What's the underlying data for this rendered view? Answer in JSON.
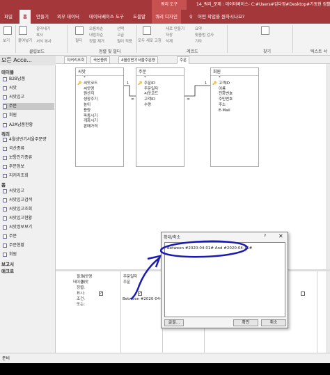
{
  "titlebar": {
    "context_tab": "쿼리 도구",
    "path": "14_쿼리_문제 : 데이터베이스- C:#Users#김다영#Desktop#기동현 컴활#"
  },
  "menu": {
    "tabs": [
      "파일",
      "홈",
      "만들기",
      "외부 데이터",
      "데이터베이스 도구",
      "도움말",
      "쿼리 디자인"
    ],
    "tell_me": "어떤 작업을 원하시나요?"
  },
  "ribbon": {
    "view": "보기",
    "clipboard": [
      "잘라내기",
      "복사",
      "서식 복사"
    ],
    "paste": "붙여넣기",
    "clipboard_group": "클립보드",
    "filter": "필터",
    "sort": [
      "오름차순",
      "내림차순",
      "정렬 제거"
    ],
    "filter_opts": [
      "선택",
      "고급",
      "필터 적용"
    ],
    "sort_group": "정렬 및 필터",
    "refresh": "모두 새로 고침",
    "records": [
      "새로 만들기",
      "저장",
      "삭제"
    ],
    "records2": [
      "요약",
      "맞춤법 검사",
      "기타"
    ],
    "records_group": "레코드",
    "find_group": "찾기",
    "text_format": "텍스트 서"
  },
  "nav": {
    "header": "모든 Acce...",
    "sections": [
      {
        "title": "테이블",
        "items": [
          "B2B납품",
          "씨앗",
          "씨앗입고",
          "주문",
          "회원"
        ]
      },
      {
        "title": "쿼리",
        "items": [
          "4월상반기서울주문량",
          "국산종류",
          "보통인기종류",
          "주문정보",
          "지커리조회"
        ]
      },
      {
        "title": "폼",
        "items": [
          "씨앗입고",
          "씨앗입고검색",
          "씨앗입고조회",
          "씨앗입고현황",
          "씨앗정보보기",
          "주문",
          "주문현황",
          "회원"
        ]
      },
      {
        "title": "보고서",
        "items": []
      },
      {
        "title": "매크로",
        "items": []
      }
    ],
    "selected": "주문"
  },
  "nav_extra_query": "A2A납품현황",
  "doc_tabs": [
    "지커리조회",
    "국산종류",
    "4월상반기서울주문량",
    "주문"
  ],
  "tables": [
    {
      "name": "씨앗",
      "fields": [
        "*",
        "씨앗코드",
        "씨앗명",
        "원산지",
        "생장주기",
        "높이",
        "용량",
        "파종시기",
        "개화시기",
        "판매가격"
      ],
      "key": 1
    },
    {
      "name": "주문",
      "fields": [
        "*",
        "주문ID",
        "주문일자",
        "씨앗코드",
        "고객ID",
        "수량"
      ],
      "key": 1
    },
    {
      "name": "회원",
      "fields": [
        "*",
        "고객ID",
        "이름",
        "전화번호",
        "주민번호",
        "주소",
        "E-Mail"
      ],
      "key": 1
    }
  ],
  "grid": {
    "row_labels": [
      "필드:",
      "테이블:",
      "정렬:",
      "표시:",
      "조건:",
      "또는:"
    ],
    "col1": {
      "field": "씨앗명",
      "table": "씨앗"
    },
    "col2": {
      "field": "주문일자",
      "table": "주문",
      "criteria": "Between #2020-04-"
    }
  },
  "status": "준비",
  "dialog": {
    "title": "확대/축소",
    "help": "?",
    "close": "✕",
    "expression": "Between #2020-04-01# And #2020-04-15#",
    "font_button": "글꼴...",
    "ok": "확인",
    "cancel": "취소"
  },
  "colors": {
    "brand": "#a4373a",
    "ink": "#1a1ab5"
  }
}
